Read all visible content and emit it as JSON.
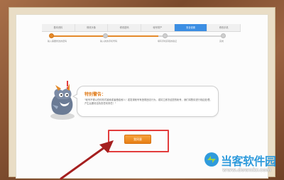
{
  "tabs": [
    {
      "label": "基本资料"
    },
    {
      "label": "修改头像"
    },
    {
      "label": "修改密码"
    },
    {
      "label": "帐号财产"
    },
    {
      "label": "安全设置"
    },
    {
      "label": "修改手机"
    }
  ],
  "steps": [
    {
      "label": "输入需要修改的密码"
    },
    {
      "label": "输入新的手机号码"
    },
    {
      "label": "填写手机获取的验证"
    },
    {
      "label": "完成"
    }
  ],
  "warning": {
    "title": "特别警告：",
    "text": "\"帐号不得以任何形式被卖或者借给他人！若发现帐号有违规违法行为，或将立即冻结您的帐号，我们将酌情进行相应处理，产生后果将自负担任何责任！\""
  },
  "confirm_button": {
    "label": "我同意"
  },
  "watermark": {
    "name": "当客软件园",
    "url": "www.downkr.com"
  },
  "colors": {
    "accent": "#e58a2a",
    "tab_active": "#3c8ee3",
    "highlight": "#e23c3c",
    "logo_blue": "#2f9bdc"
  },
  "icons": [
    "warning-mascot-icon",
    "red-arrow",
    "site-logo-icon"
  ]
}
